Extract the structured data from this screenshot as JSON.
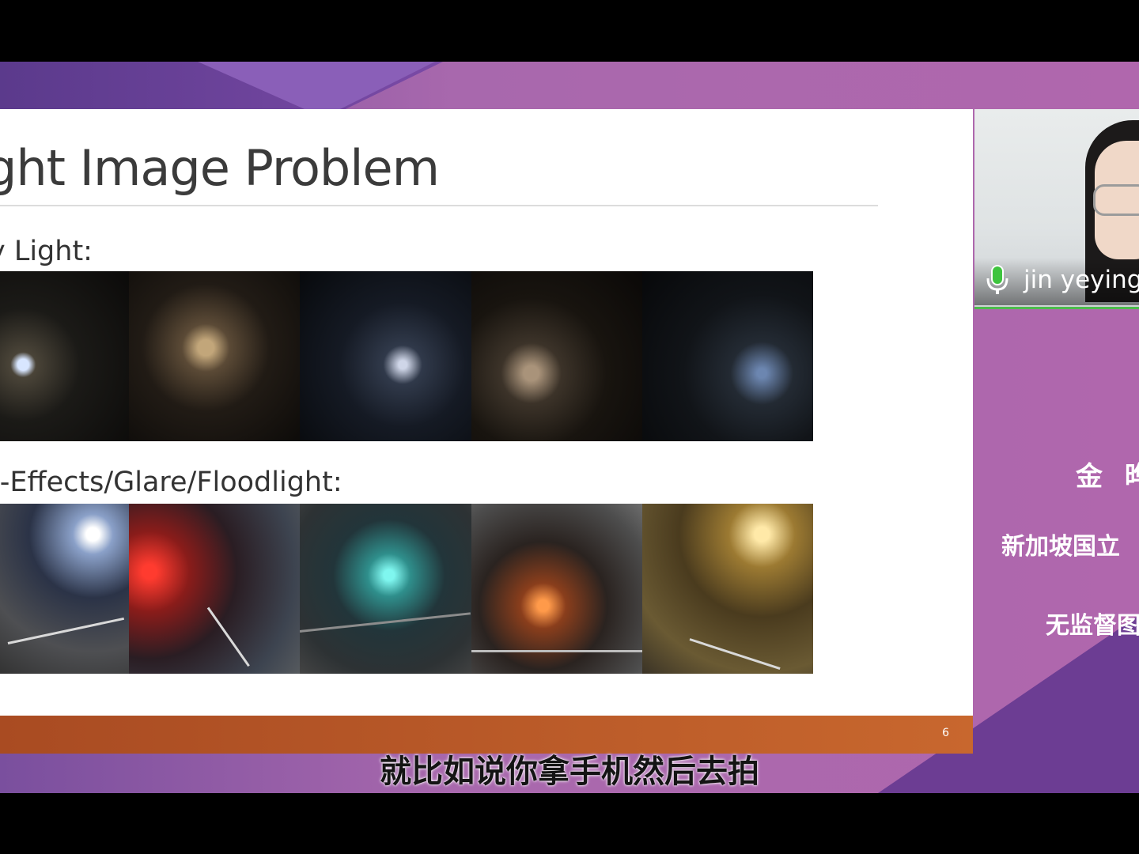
{
  "slide": {
    "title": "ght Image Problem",
    "section_low_light": "y Light:",
    "section_light_effects": "t-Effects/Glare/Floodlight:",
    "page_number": "6",
    "low_light_photos": [
      "night-house-photo",
      "night-villa-photo",
      "night-city-skyline-photo",
      "night-apartment-photo",
      "dark-building-photo"
    ],
    "light_effects_photos": [
      "floodlight-intersection-photo",
      "red-light-street-photo",
      "teal-glare-street-photo",
      "orange-streetlight-photo",
      "yellow-floodlight-road-photo"
    ]
  },
  "video": {
    "participant_name": "jin yeying",
    "mic_status": "active"
  },
  "sidebar": {
    "speaker_name": "金 晔",
    "affiliation": "新加坡国立",
    "topic": "无监督图"
  },
  "caption": {
    "subtitle": "就比如说你拿手机然后去拍"
  },
  "colors": {
    "background_purple": "#b067ad",
    "footer_orange": "#c8672e",
    "active_speaker_green": "#4dbb4d"
  }
}
